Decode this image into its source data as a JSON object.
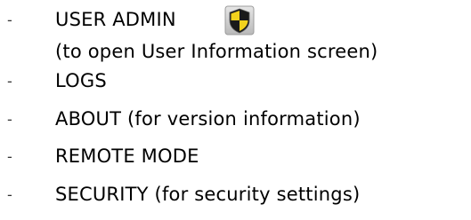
{
  "menu": {
    "items": [
      {
        "bullet": "-",
        "label": "USER ADMIN",
        "icon": "shield-icon",
        "sub": "(to open User Information screen)"
      },
      {
        "bullet": "-",
        "label": "LOGS"
      },
      {
        "bullet": "-",
        "label": "ABOUT (for version information)"
      },
      {
        "bullet": "-",
        "label": "REMOTE MODE"
      },
      {
        "bullet": "-",
        "label": "SECURITY (for security settings)"
      }
    ]
  },
  "colors": {
    "text": "#000000",
    "shield_yellow": "#f2d21c",
    "shield_black": "#1a1a1a",
    "icon_frame": "#c9c9c9"
  }
}
